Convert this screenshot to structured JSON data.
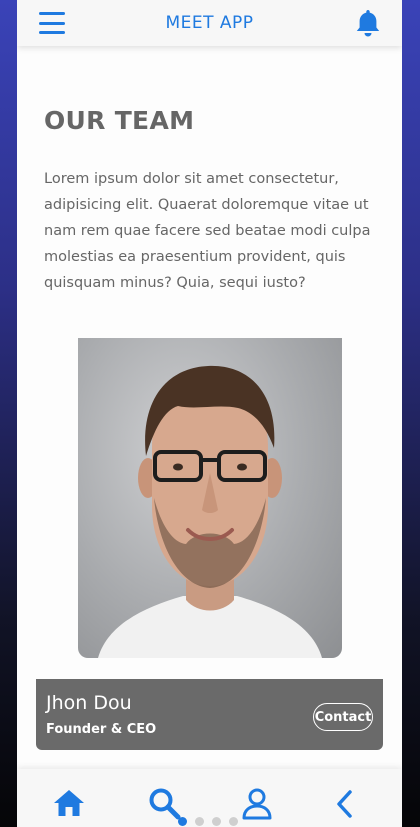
{
  "header": {
    "title": "MEET APP",
    "menu_icon": "hamburger-menu-icon",
    "notification_icon": "bell-icon",
    "accent": "#1f7ae0"
  },
  "section": {
    "title": "OUR TEAM",
    "intro": "Lorem ipsum dolor sit amet consectetur, adipisicing elit. Quaerat doloremque vitae ut nam rem quae facere sed beatae modi culpa molestias ea praesentium provident, quis quisquam minus? Quia, sequi iusto?"
  },
  "member": {
    "photo": "team-member-photo",
    "name": "Jhon Dou",
    "role": "Founder & CEO",
    "contact_label": "Contact"
  },
  "bottom_nav": {
    "items": [
      {
        "icon": "home-icon"
      },
      {
        "icon": "search-icon"
      },
      {
        "icon": "user-icon"
      },
      {
        "icon": "chevron-left-icon"
      }
    ],
    "pagination": {
      "count": 4,
      "active": 0
    }
  }
}
